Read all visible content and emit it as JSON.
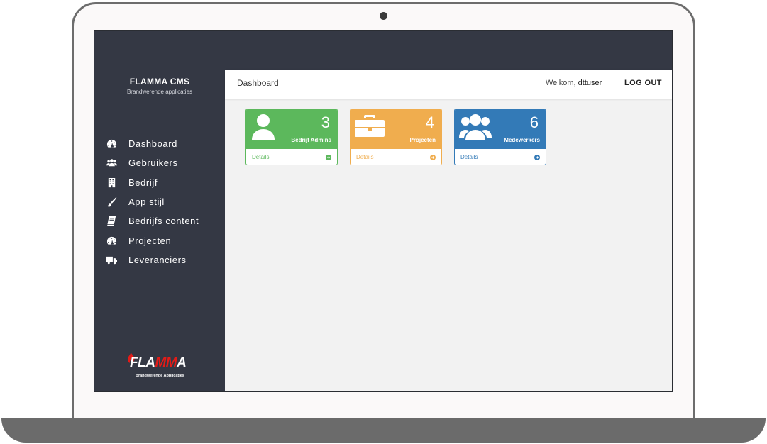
{
  "app": {
    "brand_title": "FLAMMA CMS",
    "brand_subtitle": "Brandwerende applicaties",
    "logo_text_pre": "FLA",
    "logo_text_mid": "MM",
    "logo_text_post": "A",
    "logo_tagline": "Brandwerende Applicaties"
  },
  "header": {
    "title": "Dashboard",
    "welcome_prefix": "Welkom, ",
    "username": "dttuser",
    "logout_label": "LOG OUT"
  },
  "sidebar": {
    "items": [
      {
        "label": "Dashboard",
        "icon": "dashboard-icon"
      },
      {
        "label": "Gebruikers",
        "icon": "users-icon"
      },
      {
        "label": "Bedrijf",
        "icon": "building-icon"
      },
      {
        "label": "App stijl",
        "icon": "brush-icon"
      },
      {
        "label": "Bedrijfs content",
        "icon": "book-icon"
      },
      {
        "label": "Projecten",
        "icon": "dashboard-icon"
      },
      {
        "label": "Leveranciers",
        "icon": "truck-icon"
      }
    ]
  },
  "cards": [
    {
      "count": "3",
      "label": "Bedrijf Admins",
      "details": "Details",
      "icon": "user-icon",
      "color": "#5cb85c"
    },
    {
      "count": "4",
      "label": "Projecten",
      "details": "Details",
      "icon": "briefcase-icon",
      "color": "#f0ad4e"
    },
    {
      "count": "6",
      "label": "Medewerkers",
      "details": "Details",
      "icon": "users-icon",
      "color": "#337ab7"
    }
  ],
  "colors": {
    "sidebar_bg": "#343844",
    "content_bg": "#f2f2f2",
    "logo_red": "#e41b17"
  }
}
